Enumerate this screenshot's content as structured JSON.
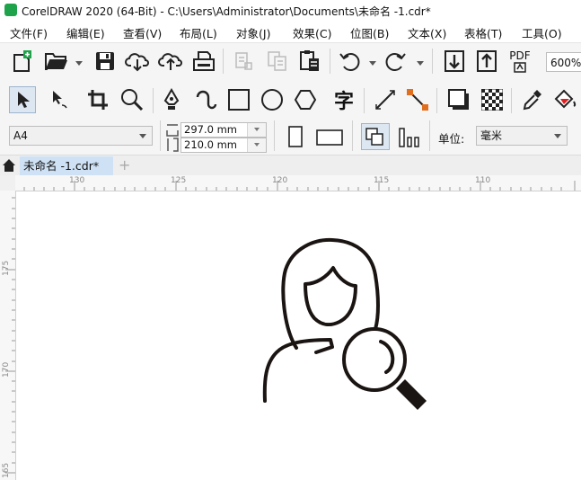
{
  "window": {
    "title": "CorelDRAW 2020 (64-Bit) - C:\\Users\\Administrator\\Documents\\未命名 -1.cdr*"
  },
  "menu": [
    "文件(F)",
    "编辑(E)",
    "查看(V)",
    "布局(L)",
    "对象(J)",
    "效果(C)",
    "位图(B)",
    "文本(X)",
    "表格(T)",
    "工具(O)"
  ],
  "toolbar": {
    "pdf_label": "PDF",
    "zoom": "600%"
  },
  "tools": {
    "text_tool_glyph": "字"
  },
  "property_bar": {
    "page_size": "A4",
    "width": "297.0 mm",
    "height": "210.0 mm",
    "units_label": "单位:",
    "units_value": "毫米"
  },
  "document_tab": {
    "label": "未命名 -1.cdr*",
    "add_tab": "+"
  },
  "rulers": {
    "horizontal": [
      "130",
      "125",
      "120",
      "115",
      "110"
    ],
    "vertical": [
      "175",
      "170",
      "165"
    ]
  },
  "colors": {
    "accent": "#1ea34a",
    "tab_active": "#cfe2f5",
    "node_highlight": "#e07020"
  },
  "canvas": {
    "artwork": "person-search-icon"
  }
}
